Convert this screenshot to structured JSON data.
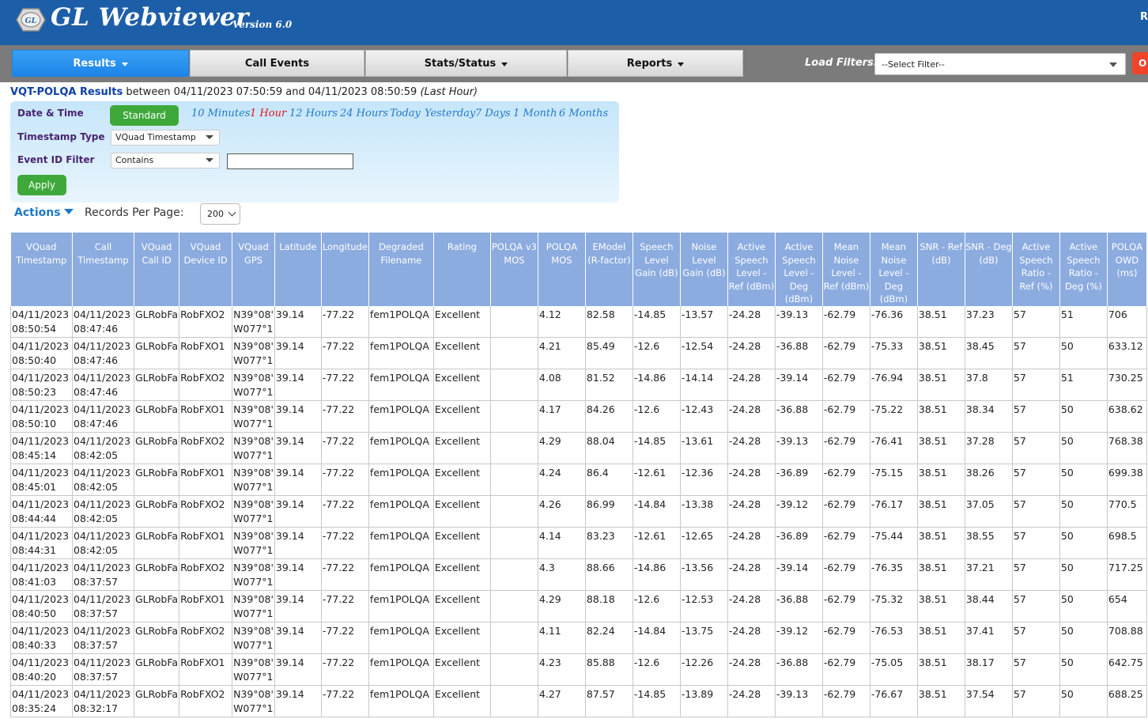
{
  "header": {
    "brand": "GL Webviewer",
    "version": "Version 6.0",
    "logo_text": "GL",
    "right_text": "R"
  },
  "nav": {
    "tabs": [
      {
        "label": "Results",
        "has_caret": true,
        "active": true
      },
      {
        "label": "Call Events",
        "has_caret": false,
        "active": false
      },
      {
        "label": "Stats/Status",
        "has_caret": true,
        "active": false
      },
      {
        "label": "Reports",
        "has_caret": true,
        "active": false
      }
    ],
    "load_filters_label": "Load Filters:",
    "filter_value": "--Select Filter--",
    "right_button_label": "O"
  },
  "results": {
    "title_bold": "VQT-POLQA Results",
    "title_mid": " between 04/11/2023 07:50:59 and 04/11/2023 08:50:59 ",
    "title_italic": "(Last Hour)"
  },
  "filters": {
    "date_time_label": "Date & Time",
    "standard_button": "Standard",
    "ranges": [
      "10 Minutes",
      "1 Hour",
      "12 Hours",
      "24 Hours",
      "Today",
      "Yesterday",
      "7 Days",
      "1 Month",
      "6 Months"
    ],
    "selected_range": "1 Hour",
    "timestamp_type_label": "Timestamp Type",
    "timestamp_type_value": "VQuad Timestamp",
    "event_id_label": "Event ID Filter",
    "event_id_mode": "Contains",
    "event_id_value": "",
    "apply_button": "Apply"
  },
  "actions": {
    "actions_label": "Actions",
    "records_per_page_label": "Records Per Page:",
    "records_per_page_value": "200"
  },
  "table": {
    "headers": [
      "VQuad Timestamp",
      "Call Timestamp",
      "VQuad Call ID",
      "VQuad Device ID",
      "VQuad GPS",
      "Latitude",
      "Longitude",
      "Degraded Filename",
      "Rating",
      "POLQA v3 MOS",
      "POLQA MOS",
      "EModel (R-factor)",
      "Speech Level Gain (dB)",
      "Noise Level Gain (dB)",
      "Active Speech Level - Ref (dBm)",
      "Active Speech Level - Deg (dBm)",
      "Mean Noise Level - Ref (dBm)",
      "Mean Noise Level - Deg (dBm)",
      "SNR - Ref (dB)",
      "SNR - Deg (dB)",
      "Active Speech Ratio - Ref (%)",
      "Active Speech Ratio - Deg (%)",
      "POLQA OWD (ms)"
    ],
    "rows": [
      [
        "04/11/2023\n08:50:54",
        "04/11/2023\n08:47:46",
        "GLRobFa",
        "RobFXO2",
        "N39°08'\nW077°1",
        "39.14",
        "-77.22",
        "fem1POLQA",
        "Excellent",
        "",
        "4.12",
        "82.58",
        "-14.85",
        "-13.57",
        "-24.28",
        "-39.13",
        "-62.79",
        "-76.36",
        "38.51",
        "37.23",
        "57",
        "51",
        "706"
      ],
      [
        "04/11/2023\n08:50:40",
        "04/11/2023\n08:47:46",
        "GLRobFa",
        "RobFXO1",
        "N39°08'\nW077°1",
        "39.14",
        "-77.22",
        "fem1POLQA",
        "Excellent",
        "",
        "4.21",
        "85.49",
        "-12.6",
        "-12.54",
        "-24.28",
        "-36.88",
        "-62.79",
        "-75.33",
        "38.51",
        "38.45",
        "57",
        "50",
        "633.12"
      ],
      [
        "04/11/2023\n08:50:23",
        "04/11/2023\n08:47:46",
        "GLRobFa",
        "RobFXO2",
        "N39°08'\nW077°1",
        "39.14",
        "-77.22",
        "fem1POLQA",
        "Excellent",
        "",
        "4.08",
        "81.52",
        "-14.86",
        "-14.14",
        "-24.28",
        "-39.14",
        "-62.79",
        "-76.94",
        "38.51",
        "37.8",
        "57",
        "51",
        "730.25"
      ],
      [
        "04/11/2023\n08:50:10",
        "04/11/2023\n08:47:46",
        "GLRobFa",
        "RobFXO1",
        "N39°08'\nW077°1",
        "39.14",
        "-77.22",
        "fem1POLQA",
        "Excellent",
        "",
        "4.17",
        "84.26",
        "-12.6",
        "-12.43",
        "-24.28",
        "-36.88",
        "-62.79",
        "-75.22",
        "38.51",
        "38.34",
        "57",
        "50",
        "638.62"
      ],
      [
        "04/11/2023\n08:45:14",
        "04/11/2023\n08:42:05",
        "GLRobFa",
        "RobFXO2",
        "N39°08'\nW077°1",
        "39.14",
        "-77.22",
        "fem1POLQA",
        "Excellent",
        "",
        "4.29",
        "88.04",
        "-14.85",
        "-13.61",
        "-24.28",
        "-39.13",
        "-62.79",
        "-76.41",
        "38.51",
        "37.28",
        "57",
        "50",
        "768.38"
      ],
      [
        "04/11/2023\n08:45:01",
        "04/11/2023\n08:42:05",
        "GLRobFa",
        "RobFXO1",
        "N39°08'\nW077°1",
        "39.14",
        "-77.22",
        "fem1POLQA",
        "Excellent",
        "",
        "4.24",
        "86.4",
        "-12.61",
        "-12.36",
        "-24.28",
        "-36.89",
        "-62.79",
        "-75.15",
        "38.51",
        "38.26",
        "57",
        "50",
        "699.38"
      ],
      [
        "04/11/2023\n08:44:44",
        "04/11/2023\n08:42:05",
        "GLRobFa",
        "RobFXO2",
        "N39°08'\nW077°1",
        "39.14",
        "-77.22",
        "fem1POLQA",
        "Excellent",
        "",
        "4.26",
        "86.99",
        "-14.84",
        "-13.38",
        "-24.28",
        "-39.12",
        "-62.79",
        "-76.17",
        "38.51",
        "37.05",
        "57",
        "50",
        "770.5"
      ],
      [
        "04/11/2023\n08:44:31",
        "04/11/2023\n08:42:05",
        "GLRobFa",
        "RobFXO1",
        "N39°08'\nW077°1",
        "39.14",
        "-77.22",
        "fem1POLQA",
        "Excellent",
        "",
        "4.14",
        "83.23",
        "-12.61",
        "-12.65",
        "-24.28",
        "-36.89",
        "-62.79",
        "-75.44",
        "38.51",
        "38.55",
        "57",
        "50",
        "698.5"
      ],
      [
        "04/11/2023\n08:41:03",
        "04/11/2023\n08:37:57",
        "GLRobFa",
        "RobFXO2",
        "N39°08'\nW077°1",
        "39.14",
        "-77.22",
        "fem1POLQA",
        "Excellent",
        "",
        "4.3",
        "88.66",
        "-14.86",
        "-13.56",
        "-24.28",
        "-39.14",
        "-62.79",
        "-76.35",
        "38.51",
        "37.21",
        "57",
        "50",
        "717.25"
      ],
      [
        "04/11/2023\n08:40:50",
        "04/11/2023\n08:37:57",
        "GLRobFa",
        "RobFXO1",
        "N39°08'\nW077°1",
        "39.14",
        "-77.22",
        "fem1POLQA",
        "Excellent",
        "",
        "4.29",
        "88.18",
        "-12.6",
        "-12.53",
        "-24.28",
        "-36.88",
        "-62.79",
        "-75.32",
        "38.51",
        "38.44",
        "57",
        "50",
        "654"
      ],
      [
        "04/11/2023\n08:40:33",
        "04/11/2023\n08:37:57",
        "GLRobFa",
        "RobFXO2",
        "N39°08'\nW077°1",
        "39.14",
        "-77.22",
        "fem1POLQA",
        "Excellent",
        "",
        "4.11",
        "82.24",
        "-14.84",
        "-13.75",
        "-24.28",
        "-39.12",
        "-62.79",
        "-76.53",
        "38.51",
        "37.41",
        "57",
        "50",
        "708.88"
      ],
      [
        "04/11/2023\n08:40:20",
        "04/11/2023\n08:37:57",
        "GLRobFa",
        "RobFXO1",
        "N39°08'\nW077°1",
        "39.14",
        "-77.22",
        "fem1POLQA",
        "Excellent",
        "",
        "4.23",
        "85.88",
        "-12.6",
        "-12.26",
        "-24.28",
        "-36.88",
        "-62.79",
        "-75.05",
        "38.51",
        "38.17",
        "57",
        "50",
        "642.75"
      ],
      [
        "04/11/2023\n08:35:24",
        "04/11/2023\n08:32:17",
        "GLRobFa",
        "RobFXO2",
        "N39°08'\nW077°1",
        "39.14",
        "-77.22",
        "fem1POLQA",
        "Excellent",
        "",
        "4.27",
        "87.57",
        "-14.85",
        "-13.89",
        "-24.28",
        "-39.13",
        "-62.79",
        "-76.67",
        "38.51",
        "37.54",
        "57",
        "50",
        "688.25"
      ]
    ]
  }
}
